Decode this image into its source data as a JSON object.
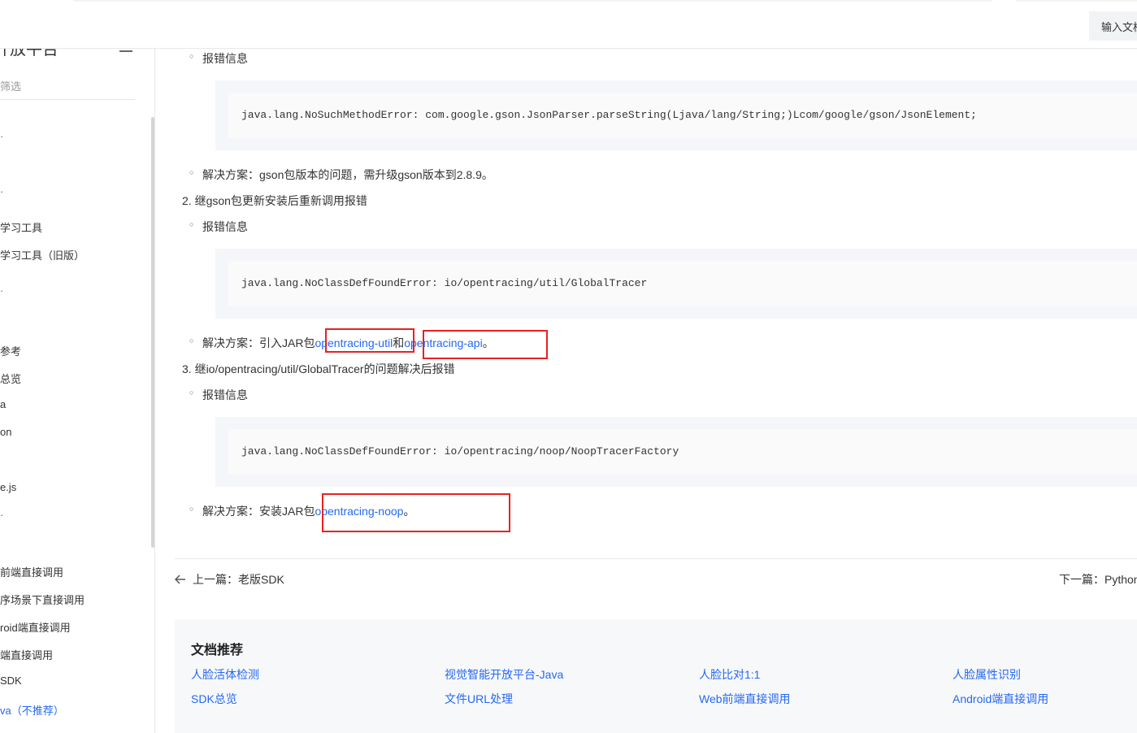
{
  "header": {
    "search_placeholder": "输入文档"
  },
  "sidebar": {
    "title": "开放平台",
    "filter_placeholder": "筛选",
    "items": [
      {
        "label": "学习工具"
      },
      {
        "label": "学习工具（旧版）"
      },
      {
        "label": "参考"
      },
      {
        "label": "总览"
      },
      {
        "label": "a"
      },
      {
        "label": "on"
      },
      {
        "label": "e.js"
      },
      {
        "label": "前端直接调用"
      },
      {
        "label": "序场景下直接调用"
      },
      {
        "label": "roid端直接调用"
      },
      {
        "label": "端直接调用"
      },
      {
        "label": "SDK"
      },
      {
        "label": "va（不推荐）"
      }
    ]
  },
  "content": {
    "sec1": {
      "error_label": "报错信息",
      "code": "java.lang.NoSuchMethodError: com.google.gson.JsonParser.parseString(Ljava/lang/String;)Lcom/google/gson/JsonElement;",
      "solution": "解决方案：gson包版本的问题，需升级gson版本到2.8.9。"
    },
    "sec2": {
      "heading": "2. 继gson包更新安装后重新调用报错",
      "error_label": "报错信息",
      "code": "java.lang.NoClassDefFoundError: io/opentracing/util/GlobalTracer",
      "solution_prefix": "解决方案：引入JAR包",
      "link1": "opentracing-util",
      "and": "和",
      "link2": "opentracing-api",
      "end": "。"
    },
    "sec3": {
      "heading": "3. 继io/opentracing/util/GlobalTracer的问题解决后报错",
      "error_label": "报错信息",
      "code": "java.lang.NoClassDefFoundError: io/opentracing/noop/NoopTracerFactory",
      "solution_prefix": "解决方案：安装JAR包",
      "link": "opentracing-noop",
      "end": "。"
    },
    "nav": {
      "prev": "上一篇：老版SDK",
      "next": "下一篇：Python"
    },
    "recommend": {
      "title": "文档推荐",
      "links": [
        "人脸活体检测",
        "视觉智能开放平台-Java",
        "人脸比对1:1",
        "人脸属性识别",
        "SDK总览",
        "文件URL处理",
        "Web前端直接调用",
        "Android端直接调用"
      ]
    }
  },
  "colors": {
    "link": "#2468f2",
    "annotation_red": "#e62222"
  }
}
